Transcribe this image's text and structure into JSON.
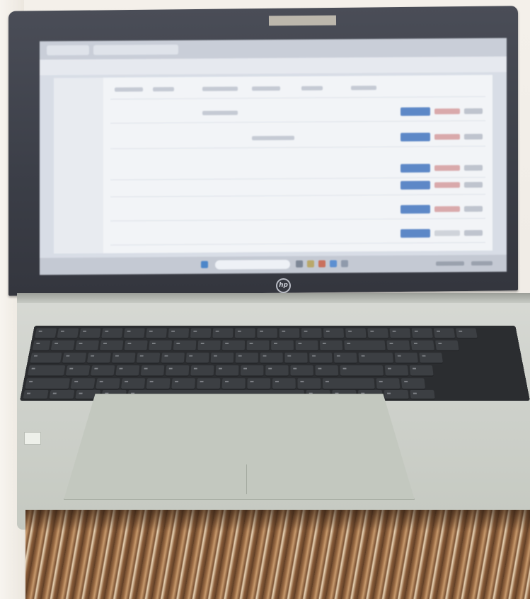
{
  "scene": {
    "subject": "laptop",
    "screen_state": "on"
  },
  "colors": {
    "bezel": "#3b3e47",
    "screen": "#d8dde6",
    "accent_button": "#5d88c7",
    "danger_button": "#d9a9ab",
    "keyboard": "#2b2d30",
    "deck": "#cfd2cc",
    "wood": "#9b6c45"
  },
  "icons": {
    "brand_logo": "hp-logo-icon"
  }
}
